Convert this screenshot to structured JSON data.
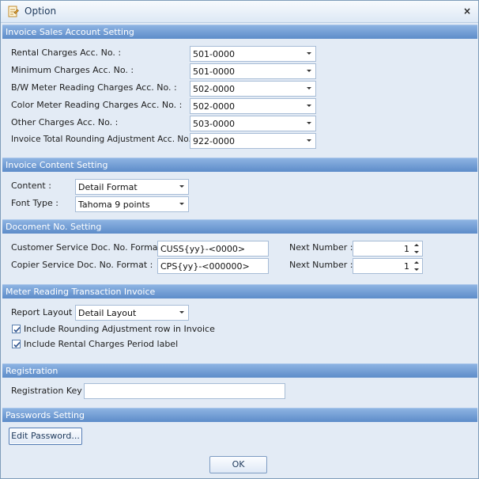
{
  "window": {
    "title": "Option",
    "close_glyph": "×",
    "icon": "option-icon",
    "close_icon": "close-icon"
  },
  "invoice_sales": {
    "header": "Invoice Sales Account Setting",
    "rows": [
      {
        "label": "Rental Charges Acc. No. :",
        "value": "501-0000"
      },
      {
        "label": "Minimum Charges Acc. No. :",
        "value": "501-0000"
      },
      {
        "label": "B/W Meter Reading Charges Acc. No. :",
        "value": "502-0000"
      },
      {
        "label": "Color Meter Reading Charges Acc. No. :",
        "value": "502-0000"
      },
      {
        "label": "Other Charges Acc. No. :",
        "value": "503-0000"
      },
      {
        "label": "Invoice Total Rounding Adjustment Acc. No. :",
        "value": "922-0000"
      }
    ]
  },
  "invoice_content": {
    "header": "Invoice Content Setting",
    "content_label": "Content :",
    "content_value": "Detail Format",
    "font_label": "Font Type :",
    "font_value": "Tahoma 9 points"
  },
  "document_no": {
    "header": "Docoment No. Setting",
    "customer_label": "Customer Service Doc. No. Format :",
    "customer_value": "CUSS{yy}-<0000>",
    "copier_label": "Copier Service Doc. No. Format :",
    "copier_value": "CPS{yy}-<000000>",
    "next_label_1": "Next Number :",
    "next_value_1": "1",
    "next_label_2": "Next Number :",
    "next_value_2": "1"
  },
  "meter_reading": {
    "header": "Meter Reading Transaction Invoice",
    "layout_label": "Report Layout :",
    "layout_value": "Detail Layout",
    "check_rounding_label": "Include Rounding Adjustment row in Invoice",
    "check_rounding": true,
    "check_period_label": "Include Rental Charges Period label",
    "check_period": true
  },
  "registration": {
    "header": "Registration",
    "key_label": "Registration Key :",
    "key_value": ""
  },
  "passwords": {
    "header": "Passwords Setting",
    "edit_button": "Edit Password..."
  },
  "footer": {
    "ok_button": "OK"
  },
  "colors": {
    "section_header_top": "#8db3e2",
    "section_header_bottom": "#5d8cc9",
    "window_bg": "#e3ebf5"
  }
}
